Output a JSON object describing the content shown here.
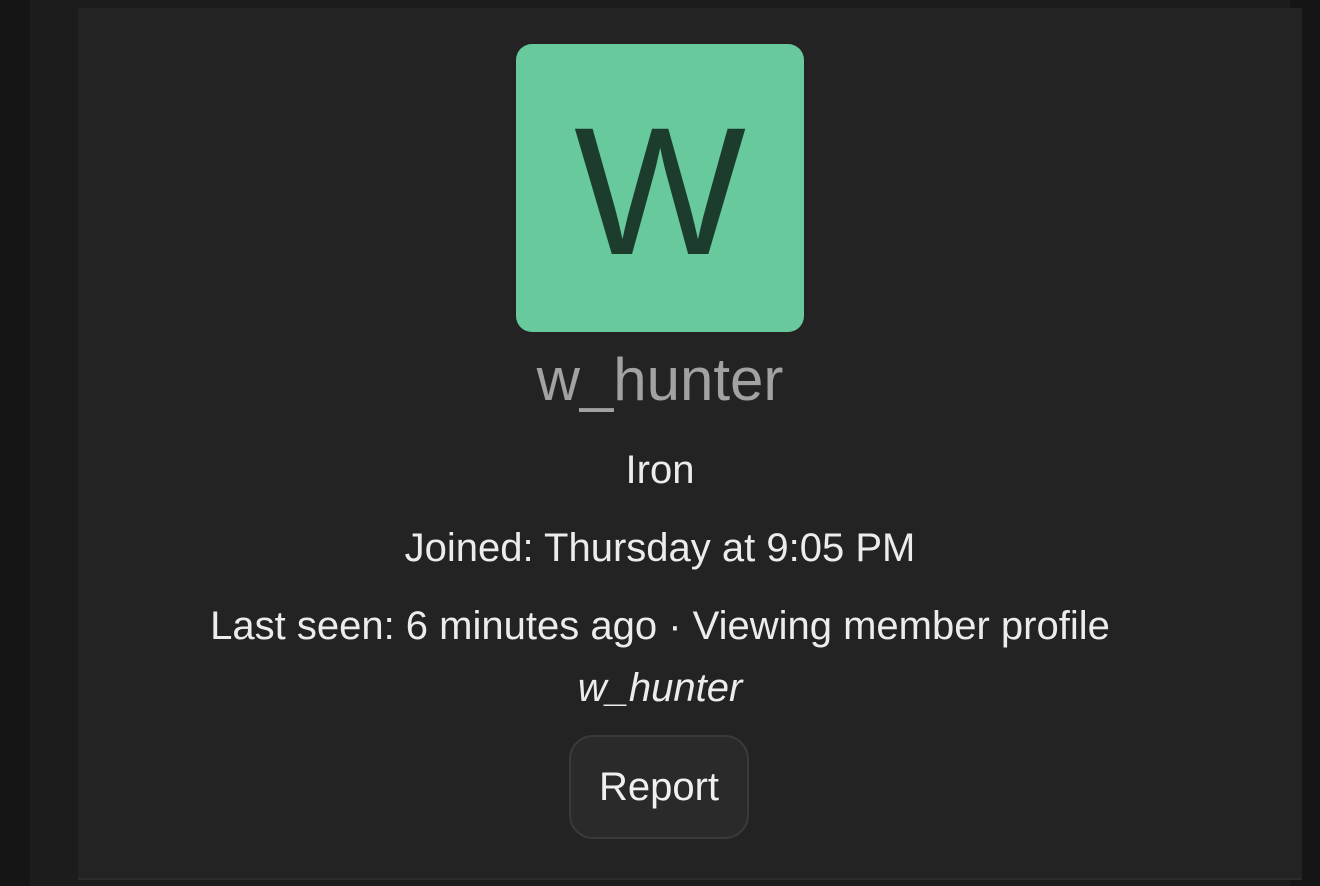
{
  "profile": {
    "avatar_letter": "W",
    "avatar_bg": "#68c99d",
    "avatar_fg": "#1c3d2d",
    "username": "w_hunter",
    "rank": "Iron",
    "joined": "Joined: Thursday at 9:05 PM",
    "last_seen": "Last seen: 6 minutes ago · Viewing member profile",
    "activity_target": "w_hunter"
  },
  "actions": {
    "report_label": "Report"
  }
}
